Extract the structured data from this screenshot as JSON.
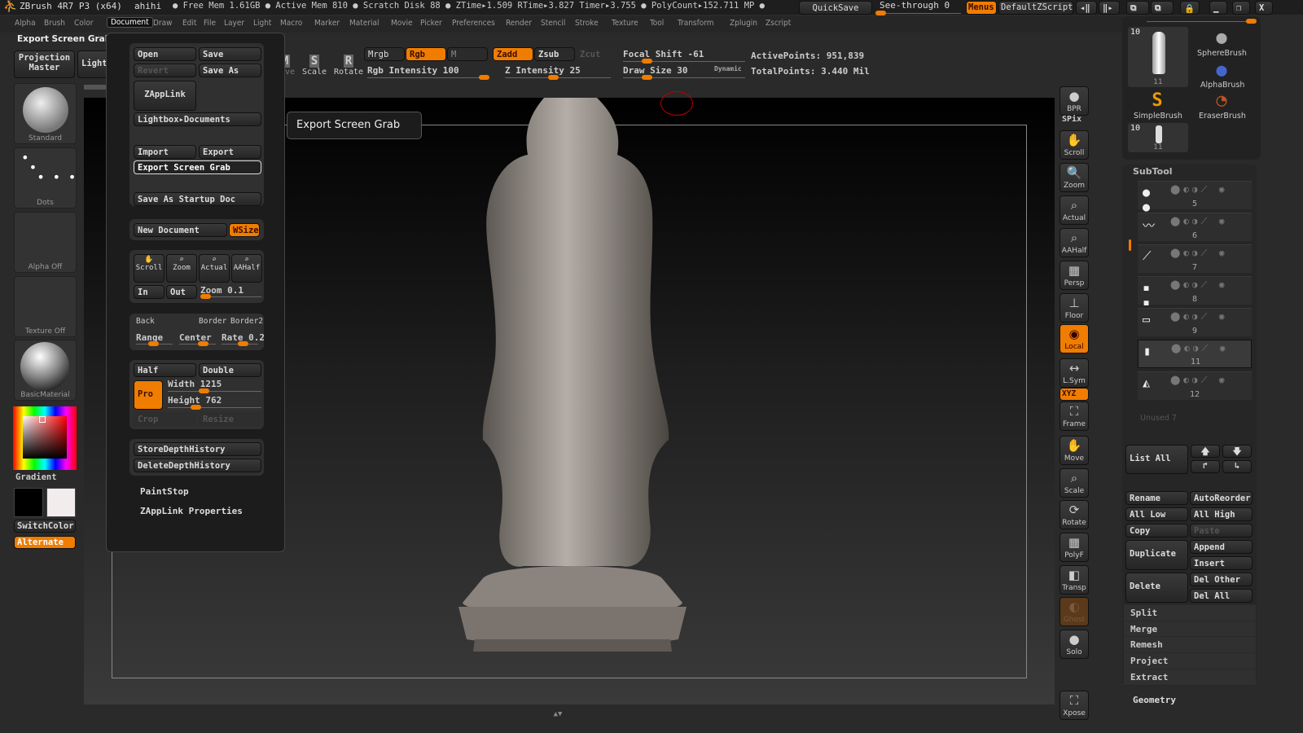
{
  "titlebar": {
    "app": "ZBrush 4R7 P3 (x64)",
    "doc": "ahihi",
    "stats": "● Free Mem 1.61GB ● Active Mem 810 ● Scratch Disk 88 ●  ZTime▸1.509 RTime▸3.827 Timer▸3.755 ● PolyCount▸152.711 MP ●",
    "quicksave": "QuickSave",
    "seethrough": "See-through  0",
    "seethrough_value": 0,
    "menus": "Menus",
    "script": "DefaultZScript"
  },
  "menubar": {
    "items": [
      "Alpha",
      "Brush",
      "Color",
      "Document",
      "Draw",
      "Edit",
      "File",
      "Layer",
      "Light",
      "Macro",
      "Marker",
      "Material",
      "Movie",
      "Picker",
      "Preferences",
      "Render",
      "Stencil",
      "Stroke",
      "Texture",
      "Tool",
      "Transform",
      "Zplugin",
      "Zscript"
    ],
    "active": "Document"
  },
  "tooltip_top": "Export Screen Grab",
  "left_shelf": {
    "projection_master": "Projection Master",
    "lightbox": "LightBox",
    "brush": "Standard",
    "stroke": "Dots",
    "alpha": "Alpha Off",
    "texture": "Texture Off",
    "material": "BasicMaterial",
    "gradient": "Gradient",
    "switchcolor": "SwitchColor",
    "alternate": "Alternate"
  },
  "toolbar": {
    "move": "Move",
    "scale": "Scale",
    "rotate": "Rotate",
    "mrgb": "Mrgb",
    "rgb": "Rgb",
    "m": "M",
    "zadd": "Zadd",
    "zsub": "Zsub",
    "zcut": "Zcut",
    "rgb_intensity": "Rgb Intensity 100",
    "z_intensity": "Z Intensity 25",
    "focal_shift": "Focal Shift -61",
    "draw_size": "Draw Size 30",
    "dynamic": "Dynamic",
    "active_points": "ActivePoints: 951,839",
    "total_points": "TotalPoints: 3.440 Mil"
  },
  "document_menu": {
    "open": "Open",
    "save": "Save",
    "revert": "Revert",
    "save_as": "Save As",
    "zapplink": "ZAppLink",
    "lightbox_docs": "Lightbox▸Documents",
    "import": "Import",
    "export": "Export",
    "export_screen_grab": "Export Screen Grab",
    "save_startup": "Save As Startup Doc",
    "new_document": "New Document",
    "wsize": "WSize",
    "scroll": "Scroll",
    "zoom": "Zoom",
    "actual": "Actual",
    "aahalf": "AAHalf",
    "in": "In",
    "out": "Out",
    "zoom_value": "Zoom 0.1",
    "back": "Back",
    "border": "Border",
    "border2": "Border2",
    "range": "Range",
    "center": "Center",
    "rate": "Rate 0.2",
    "half": "Half",
    "double": "Double",
    "pro": "Pro",
    "width": "Width 1215",
    "height": "Height 762",
    "crop": "Crop",
    "resize": "Resize",
    "store_depth": "StoreDepthHistory",
    "delete_depth": "DeleteDepthHistory",
    "paintstop": "PaintStop",
    "zapplink_props": "ZAppLink Properties"
  },
  "tooltip": "Export Screen Grab",
  "right_shelf": [
    {
      "label": "BPR",
      "g": "●"
    },
    {
      "label": "SPix",
      "g": ""
    },
    {
      "label": "Scroll",
      "g": "✋"
    },
    {
      "label": "Zoom",
      "g": "🔍"
    },
    {
      "label": "Actual",
      "g": "⌕"
    },
    {
      "label": "AAHalf",
      "g": "⌕"
    },
    {
      "label": "Persp",
      "g": "▦"
    },
    {
      "label": "Floor",
      "g": "⊥"
    },
    {
      "label": "Local",
      "g": "◉"
    },
    {
      "label": "L.Sym",
      "g": "↔"
    },
    {
      "label": "XYZ",
      "g": ""
    },
    {
      "label": "Frame",
      "g": "⛶"
    },
    {
      "label": "Move",
      "g": "✋"
    },
    {
      "label": "Scale",
      "g": "⌕"
    },
    {
      "label": "Rotate",
      "g": "⟳"
    },
    {
      "label": "PolyF",
      "g": "▦"
    },
    {
      "label": "Transp",
      "g": "◧"
    },
    {
      "label": "Ghost",
      "g": "◐"
    },
    {
      "label": "Solo",
      "g": "●"
    },
    {
      "label": "Xpose",
      "g": "⛶"
    }
  ],
  "tool_palette": {
    "thumb_count": "10",
    "thumb_sub": "11",
    "brushes": [
      "SphereBrush",
      "AlphaBrush",
      "SimpleBrush",
      "EraserBrush"
    ],
    "thumb2_count": "10",
    "thumb2_sub": "11"
  },
  "subtool": {
    "title": "SubTool",
    "rows": [
      {
        "num": "5",
        "selected": false
      },
      {
        "num": "6",
        "selected": false
      },
      {
        "num": "7",
        "selected": false
      },
      {
        "num": "8",
        "selected": false
      },
      {
        "num": "9",
        "selected": false
      },
      {
        "num": "11",
        "selected": true
      },
      {
        "num": "12",
        "selected": false
      }
    ],
    "unused": "Unused 7",
    "list_all": "List All",
    "rename": "Rename",
    "autoreorder": "AutoReorder",
    "all_low": "All Low",
    "all_high": "All High",
    "copy": "Copy",
    "paste": "Paste",
    "duplicate": "Duplicate",
    "append": "Append",
    "insert": "Insert",
    "delete": "Delete",
    "del_other": "Del Other",
    "del_all": "Del All",
    "actions": [
      "Split",
      "Merge",
      "Remesh",
      "Project",
      "Extract"
    ],
    "geometry": "Geometry"
  },
  "colors": {
    "accent": "#f07c00",
    "bg": "#2a2a2a"
  }
}
